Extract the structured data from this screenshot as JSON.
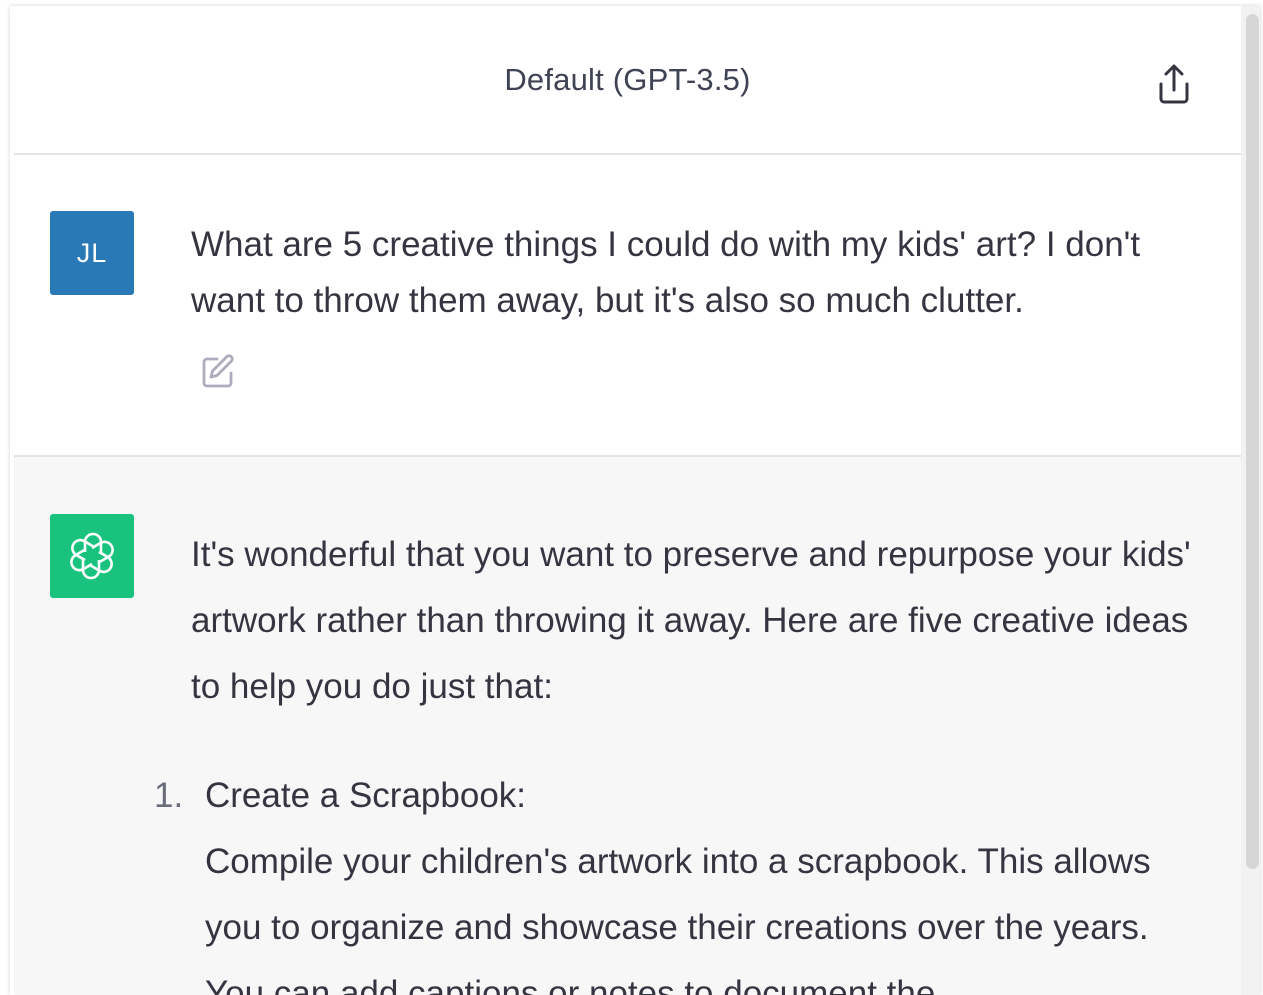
{
  "header": {
    "title": "Default (GPT-3.5)",
    "share_icon": "share-upload-icon"
  },
  "user_message": {
    "avatar_initials": "JL",
    "avatar_color": "#2979b6",
    "text": "What are 5 creative things I could do with my kids' art? I don't want to throw them away, but it's also so much clutter.",
    "edit_icon": "edit-pencil-icon"
  },
  "assistant_message": {
    "avatar_icon": "openai-logo-icon",
    "avatar_color": "#19c37d",
    "intro": "It's wonderful that you want to preserve and repurpose your kids' artwork rather than throwing it away. Here are five creative ideas to help you do just that:",
    "items": [
      {
        "number": "1.",
        "title": "Create a Scrapbook:",
        "body": "Compile your children's artwork into a scrapbook. This allows you to organize and showcase their creations over the years. You can add captions or notes to document the"
      }
    ]
  },
  "colors": {
    "text": "#343541",
    "assistant_bg": "#f7f7f8",
    "divider": "#e3e3e6"
  }
}
